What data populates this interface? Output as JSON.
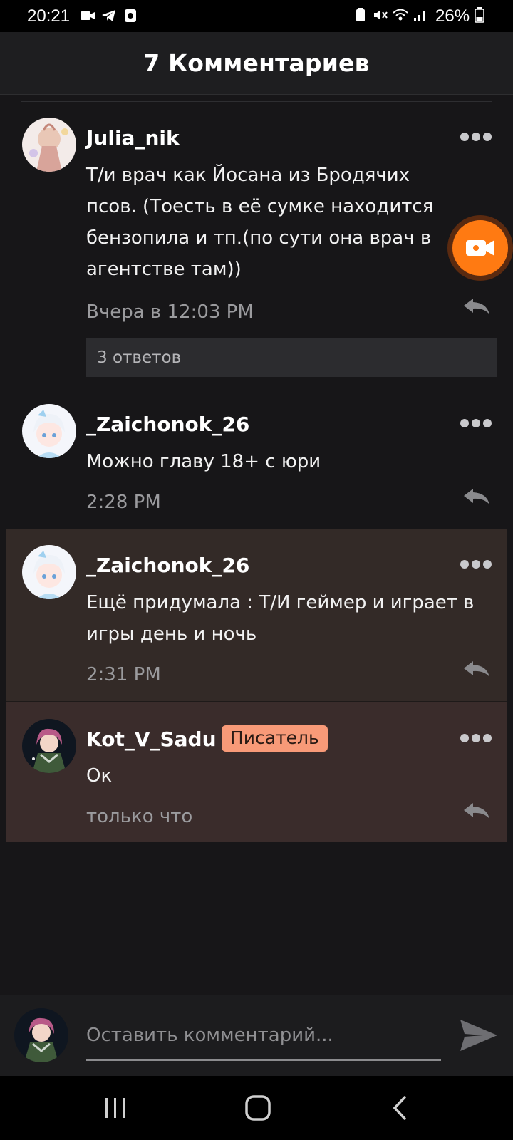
{
  "status_bar": {
    "time": "20:21",
    "battery": "26%"
  },
  "header": {
    "title": "7 Комментариев"
  },
  "comments": [
    {
      "username": "Julia_nik",
      "text": "Т/и врач как Йосана  из Бродячих псов. (Тоесть в её сумке находится бензопила и тп.(по сути она врач в агентстве там))",
      "time": "Вчера в 12:03 PM",
      "replies": "3 ответов"
    },
    {
      "username": "_Zaichonok_26",
      "text": "Можно главу 18+ с юри",
      "time": "2:28 PM"
    },
    {
      "username": "_Zaichonok_26",
      "text": "Ещё придумала : Т/И геймер и играет в игры день и ночь",
      "time": "2:31 PM"
    },
    {
      "username": "Kot_V_Sadu",
      "badge": "Писатель",
      "text": "Ок",
      "time": "только что"
    }
  ],
  "input": {
    "placeholder": "Оставить комментарий..."
  },
  "colors": {
    "accent": "#ff7a12",
    "badge": "#f89a78",
    "highlight": "#332a27"
  }
}
